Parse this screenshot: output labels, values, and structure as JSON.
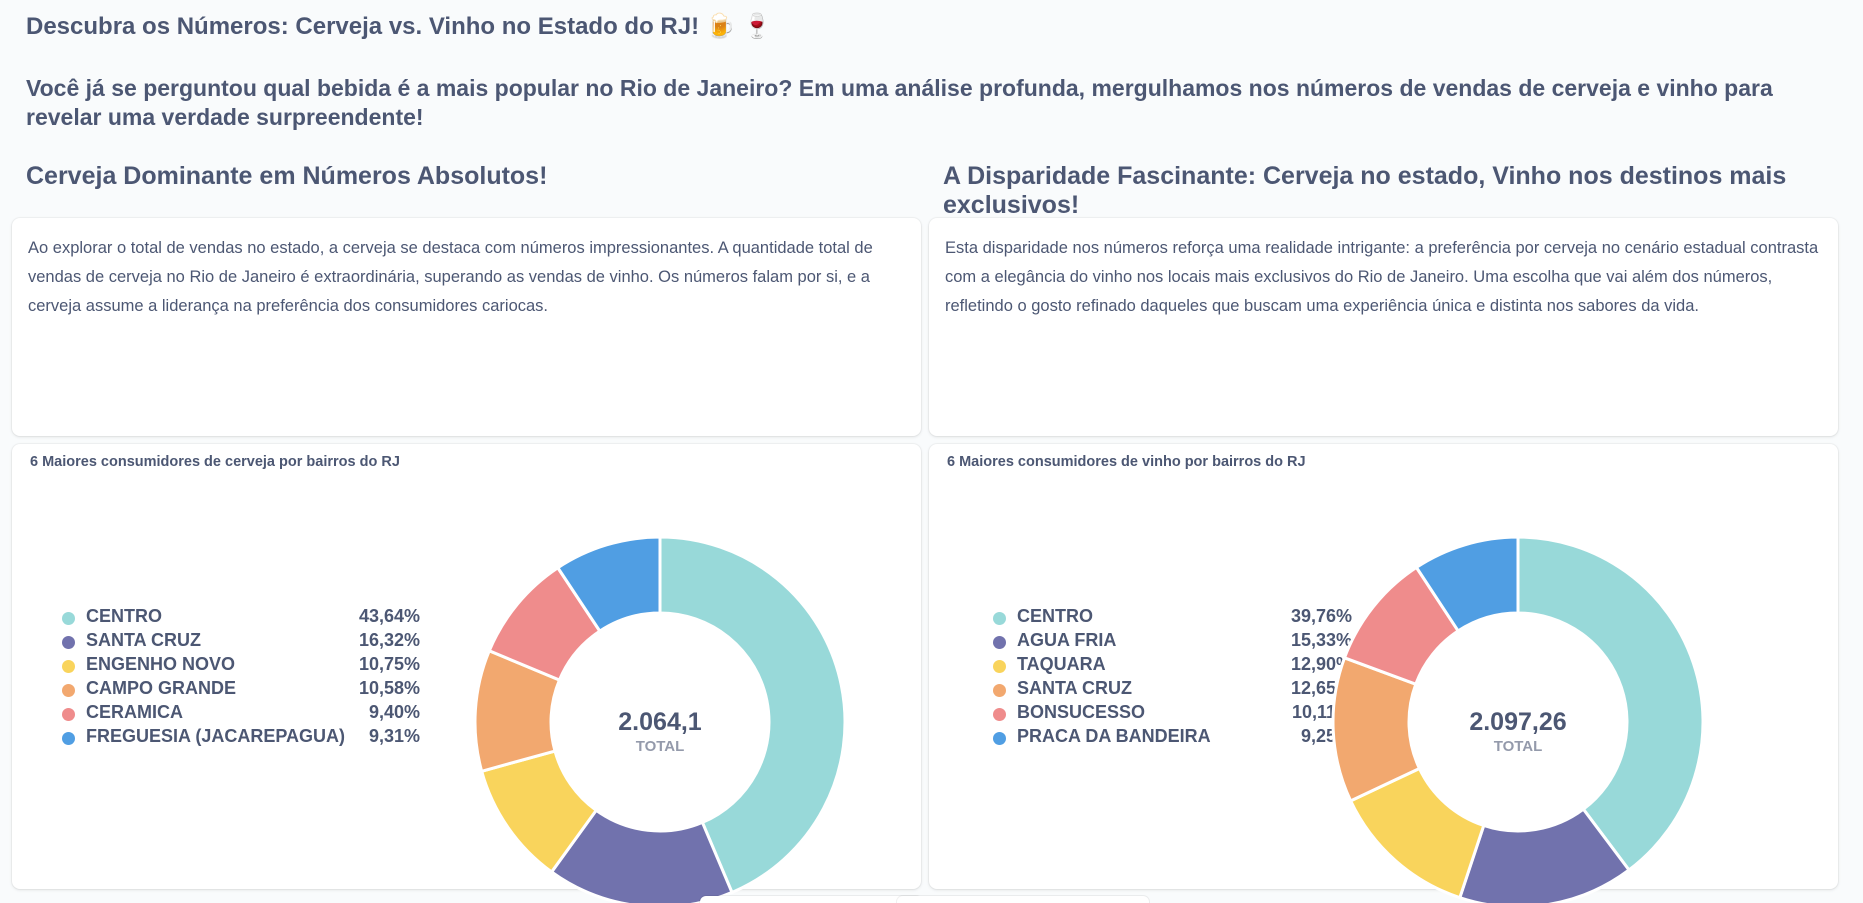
{
  "header": {
    "title": "Descubra os Números: Cerveja vs. Vinho no Estado do RJ! 🍺 🍷",
    "intro": "Você já se perguntou qual bebida é a mais popular no Rio de Janeiro? Em uma análise profunda, mergulhamos nos números de vendas de cerveja e vinho para revelar uma verdade surpreendente!"
  },
  "sections": {
    "left_title": "Cerveja Dominante em Números Absolutos!",
    "right_title": "A Disparidade Fascinante: Cerveja no estado, Vinho nos destinos mais exclusivos!",
    "left_text": "Ao explorar o total de vendas no estado, a cerveja se destaca com números impressionantes. A quantidade total de vendas de cerveja no Rio de Janeiro é extraordinária, superando as vendas de vinho. Os números falam por si, e a cerveja assume a liderança na preferência dos consumidores cariocas.",
    "right_text": "Esta disparidade nos números reforça uma realidade intrigante: a preferência por cerveja no cenário estadual contrasta com a elegância do vinho nos locais mais exclusivos do Rio de Janeiro. Uma escolha que vai além dos números, refletindo o gosto refinado daqueles que buscam uma experiência única e distinta nos sabores da vida."
  },
  "colors": [
    "#98d9d9",
    "#7172ad",
    "#f9d45c",
    "#f2a86f",
    "#ef8c8c",
    "#509ee3"
  ],
  "chart_data": [
    {
      "type": "pie",
      "title": "6 Maiores consumidores de cerveja por bairros do RJ",
      "total_value": "2.064,1",
      "total_label": "TOTAL",
      "categories": [
        "CENTRO",
        "SANTA CRUZ",
        "ENGENHO NOVO",
        "CAMPO GRANDE",
        "CERAMICA",
        "FREGUESIA (JACAREPAGUA)"
      ],
      "values": [
        43.64,
        16.32,
        10.75,
        10.58,
        9.4,
        9.31
      ],
      "value_labels": [
        "43,64%",
        "16,32%",
        "10,75%",
        "10,58%",
        "9,40%",
        "9,31%"
      ],
      "legend_position": "left"
    },
    {
      "type": "pie",
      "title": "6 Maiores consumidores de vinho por bairros do RJ",
      "total_value": "2.097,26",
      "total_label": "TOTAL",
      "categories": [
        "CENTRO",
        "AGUA FRIA",
        "TAQUARA",
        "SANTA CRUZ",
        "BONSUCESSO",
        "PRACA DA BANDEIRA"
      ],
      "values": [
        39.76,
        15.33,
        12.9,
        12.65,
        10.11,
        9.25
      ],
      "value_labels": [
        "39,76%",
        "15,33%",
        "12,90%",
        "12,65%",
        "10,11%",
        "9,25%"
      ],
      "legend_position": "left"
    }
  ]
}
